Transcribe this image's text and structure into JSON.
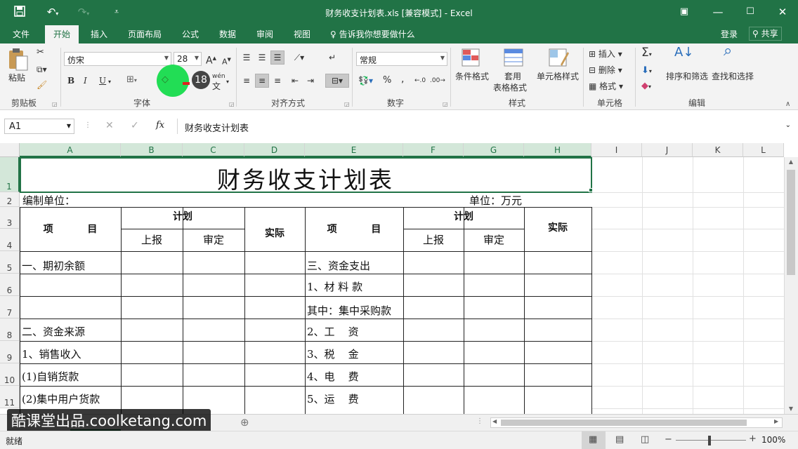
{
  "window": {
    "title": "财务收支计划表.xls  [兼容模式] - Excel",
    "icons": [
      "save-icon",
      "undo-icon",
      "redo-icon",
      "customize-icon",
      "ribbon-display-icon",
      "minimize-icon",
      "maximize-icon",
      "close-icon"
    ]
  },
  "tabs": [
    "文件",
    "开始",
    "插入",
    "页面布局",
    "公式",
    "数据",
    "审阅",
    "视图"
  ],
  "active_tab": "开始",
  "tell_me": "告诉我你想要做什么",
  "login": "登录",
  "share": "共享",
  "ribbon": {
    "clipboard": {
      "label": "剪贴板",
      "paste": "粘贴"
    },
    "font": {
      "label": "字体",
      "name": "仿宋",
      "size": "28",
      "grow": "A",
      "shrink": "A",
      "bold": "B",
      "italic": "I",
      "underline": "U",
      "phonetic_top": "wén",
      "phonetic_bottom": "文",
      "font_color_overlay": "18"
    },
    "alignment": {
      "label": "对齐方式"
    },
    "number": {
      "label": "数字",
      "format": "常规",
      "percent": "%",
      "comma": ","
    },
    "styles": {
      "label": "样式",
      "conditional": "条件格式",
      "table1": "套用",
      "table2": "表格格式",
      "cell_styles": "单元格样式"
    },
    "cells": {
      "label": "单元格",
      "insert": "插入",
      "delete": "删除",
      "format": "格式"
    },
    "editing": {
      "label": "编辑",
      "sort": "排序和筛选",
      "find": "查找和选择"
    }
  },
  "formula_bar": {
    "name_box": "A1",
    "fx": "fx",
    "content": "财务收支计划表"
  },
  "columns": [
    "A",
    "B",
    "C",
    "D",
    "E",
    "F",
    "G",
    "H",
    "I",
    "J",
    "K",
    "L"
  ],
  "rows": [
    "1",
    "2",
    "3",
    "4",
    "5",
    "6",
    "7",
    "8",
    "9",
    "10",
    "11"
  ],
  "sheet": {
    "title": "财务收支计划表",
    "unit_left": "编制单位：",
    "unit_right": "单位：万元",
    "h_item1": "项          目",
    "h_plan1": "计划",
    "h_report1": "上报",
    "h_approve1": "审定",
    "h_actual1": "实际",
    "h_item2": "项          目",
    "h_plan2": "计划",
    "h_report2": "上报",
    "h_approve2": "审定",
    "h_actual2": "实际",
    "a5": "一、期初余额",
    "a8": "二、资金来源",
    "a9": "1、销售收入",
    "a10": "(1)自销货款",
    "a11": "(2)集中用户货款",
    "e5": "三、资金支出",
    "e6": "1、材 料 款",
    "e7": "其中：集中采购款",
    "e8": "2、工    资",
    "e9": "3、税    金",
    "e10": "4、电    费",
    "e11": "5、运    费"
  },
  "watermark": "酷课堂出品.coolketang.com",
  "status": {
    "ready": "就绪",
    "zoom": "100%"
  },
  "colors": {
    "excel_green": "#217346",
    "cursor_highlight": "#22dd55"
  }
}
